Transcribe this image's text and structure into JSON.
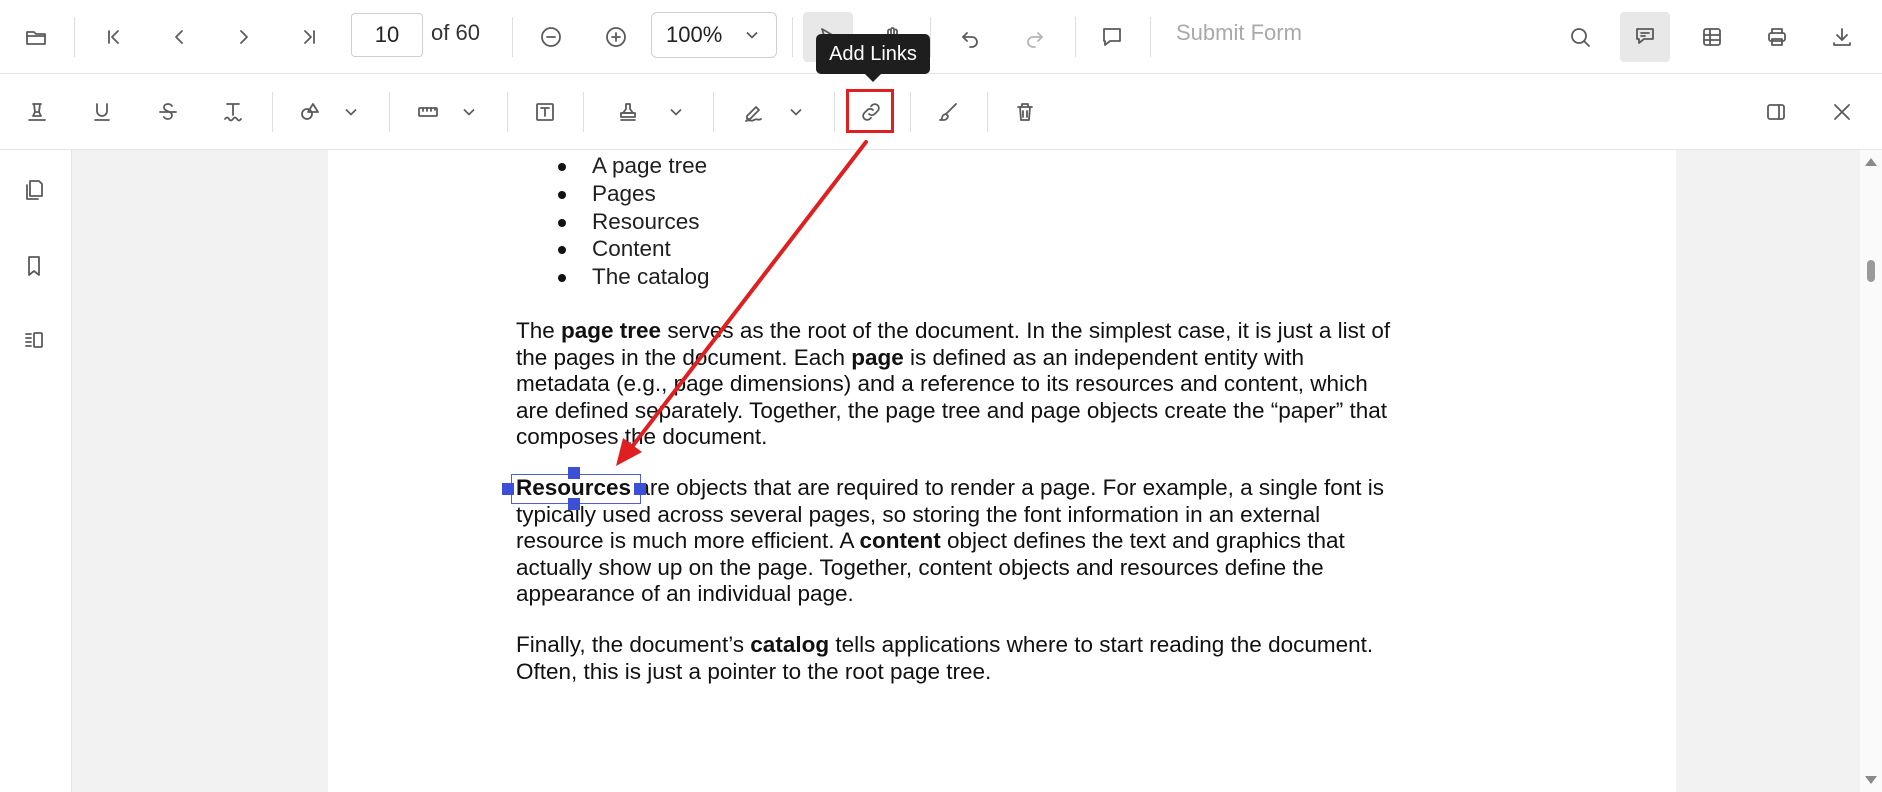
{
  "toolbar": {
    "page_current": "10",
    "page_of": "of 60",
    "zoom": "100%",
    "submit_form": "Submit Form",
    "tooltip": "Add Links"
  },
  "icons": {
    "open": "folder-icon",
    "first": "first-page-icon",
    "prev": "previous-page-icon",
    "next": "next-page-icon",
    "last": "last-page-icon",
    "zoom_out": "zoom-out-icon",
    "zoom_in": "zoom-in-icon",
    "select": "select-pointer-icon",
    "pan": "pan-hand-icon",
    "undo": "undo-icon",
    "redo": "redo-icon",
    "comment": "comment-icon",
    "search": "search-icon",
    "annotate": "annotate-icon",
    "form": "form-fields-icon",
    "print": "print-icon",
    "download": "download-icon",
    "highlight": "highlight-icon",
    "underline": "underline-icon",
    "strikethrough": "strikethrough-icon",
    "squiggly": "squiggly-icon",
    "shapes": "shapes-icon",
    "measure": "ruler-icon",
    "free_text": "free-text-icon",
    "stamp": "stamp-icon",
    "signature": "signature-icon",
    "link": "link-icon",
    "ink": "ink-brush-icon",
    "delete": "trash-icon",
    "panel": "panel-icon",
    "close": "close-icon",
    "thumbnails": "page-thumbnails-icon",
    "bookmarks": "bookmark-icon",
    "organize": "organize-pages-icon"
  },
  "document": {
    "bullets": [
      "A page tree",
      "Pages",
      "Resources",
      "Content",
      "The catalog"
    ],
    "p1": [
      {
        "pre": "The ",
        "bold": "page tree",
        "post": " serves as the root of the document. In the simplest case, it is just a list of"
      },
      {
        "pre": "the pages in the document. Each ",
        "bold": "page",
        "post": " is defined as an independent entity with"
      },
      {
        "pre": "metadata (e.g., page dimensions) and a reference to its resources and content, which",
        "bold": "",
        "post": ""
      },
      {
        "pre": "are defined separately. Together, the page tree and page objects create the “paper” that",
        "bold": "",
        "post": ""
      },
      {
        "pre": "composes the document.",
        "bold": "",
        "post": ""
      }
    ],
    "p2": [
      {
        "pre": "",
        "bold": "Resources",
        "post": " are objects that are required to render a page. For example, a single font is"
      },
      {
        "pre": "typically used across several pages, so storing the font information in an external",
        "bold": "",
        "post": ""
      },
      {
        "pre": "resource is much more efficient. A ",
        "bold": "content",
        "post": " object defines the text and graphics that"
      },
      {
        "pre": "actually show up on the page. Together, content objects and resources define the",
        "bold": "",
        "post": ""
      },
      {
        "pre": "appearance of an individual page.",
        "bold": "",
        "post": ""
      }
    ],
    "p3": [
      {
        "pre": "Finally, the document’s ",
        "bold": "catalog",
        "post": " tells applications where to start reading the document."
      },
      {
        "pre": "Often, this is just a pointer to the root page tree.",
        "bold": "",
        "post": ""
      }
    ]
  },
  "colors": {
    "annotation_red": "#e02020",
    "selection_blue": "#3b4fd8"
  }
}
